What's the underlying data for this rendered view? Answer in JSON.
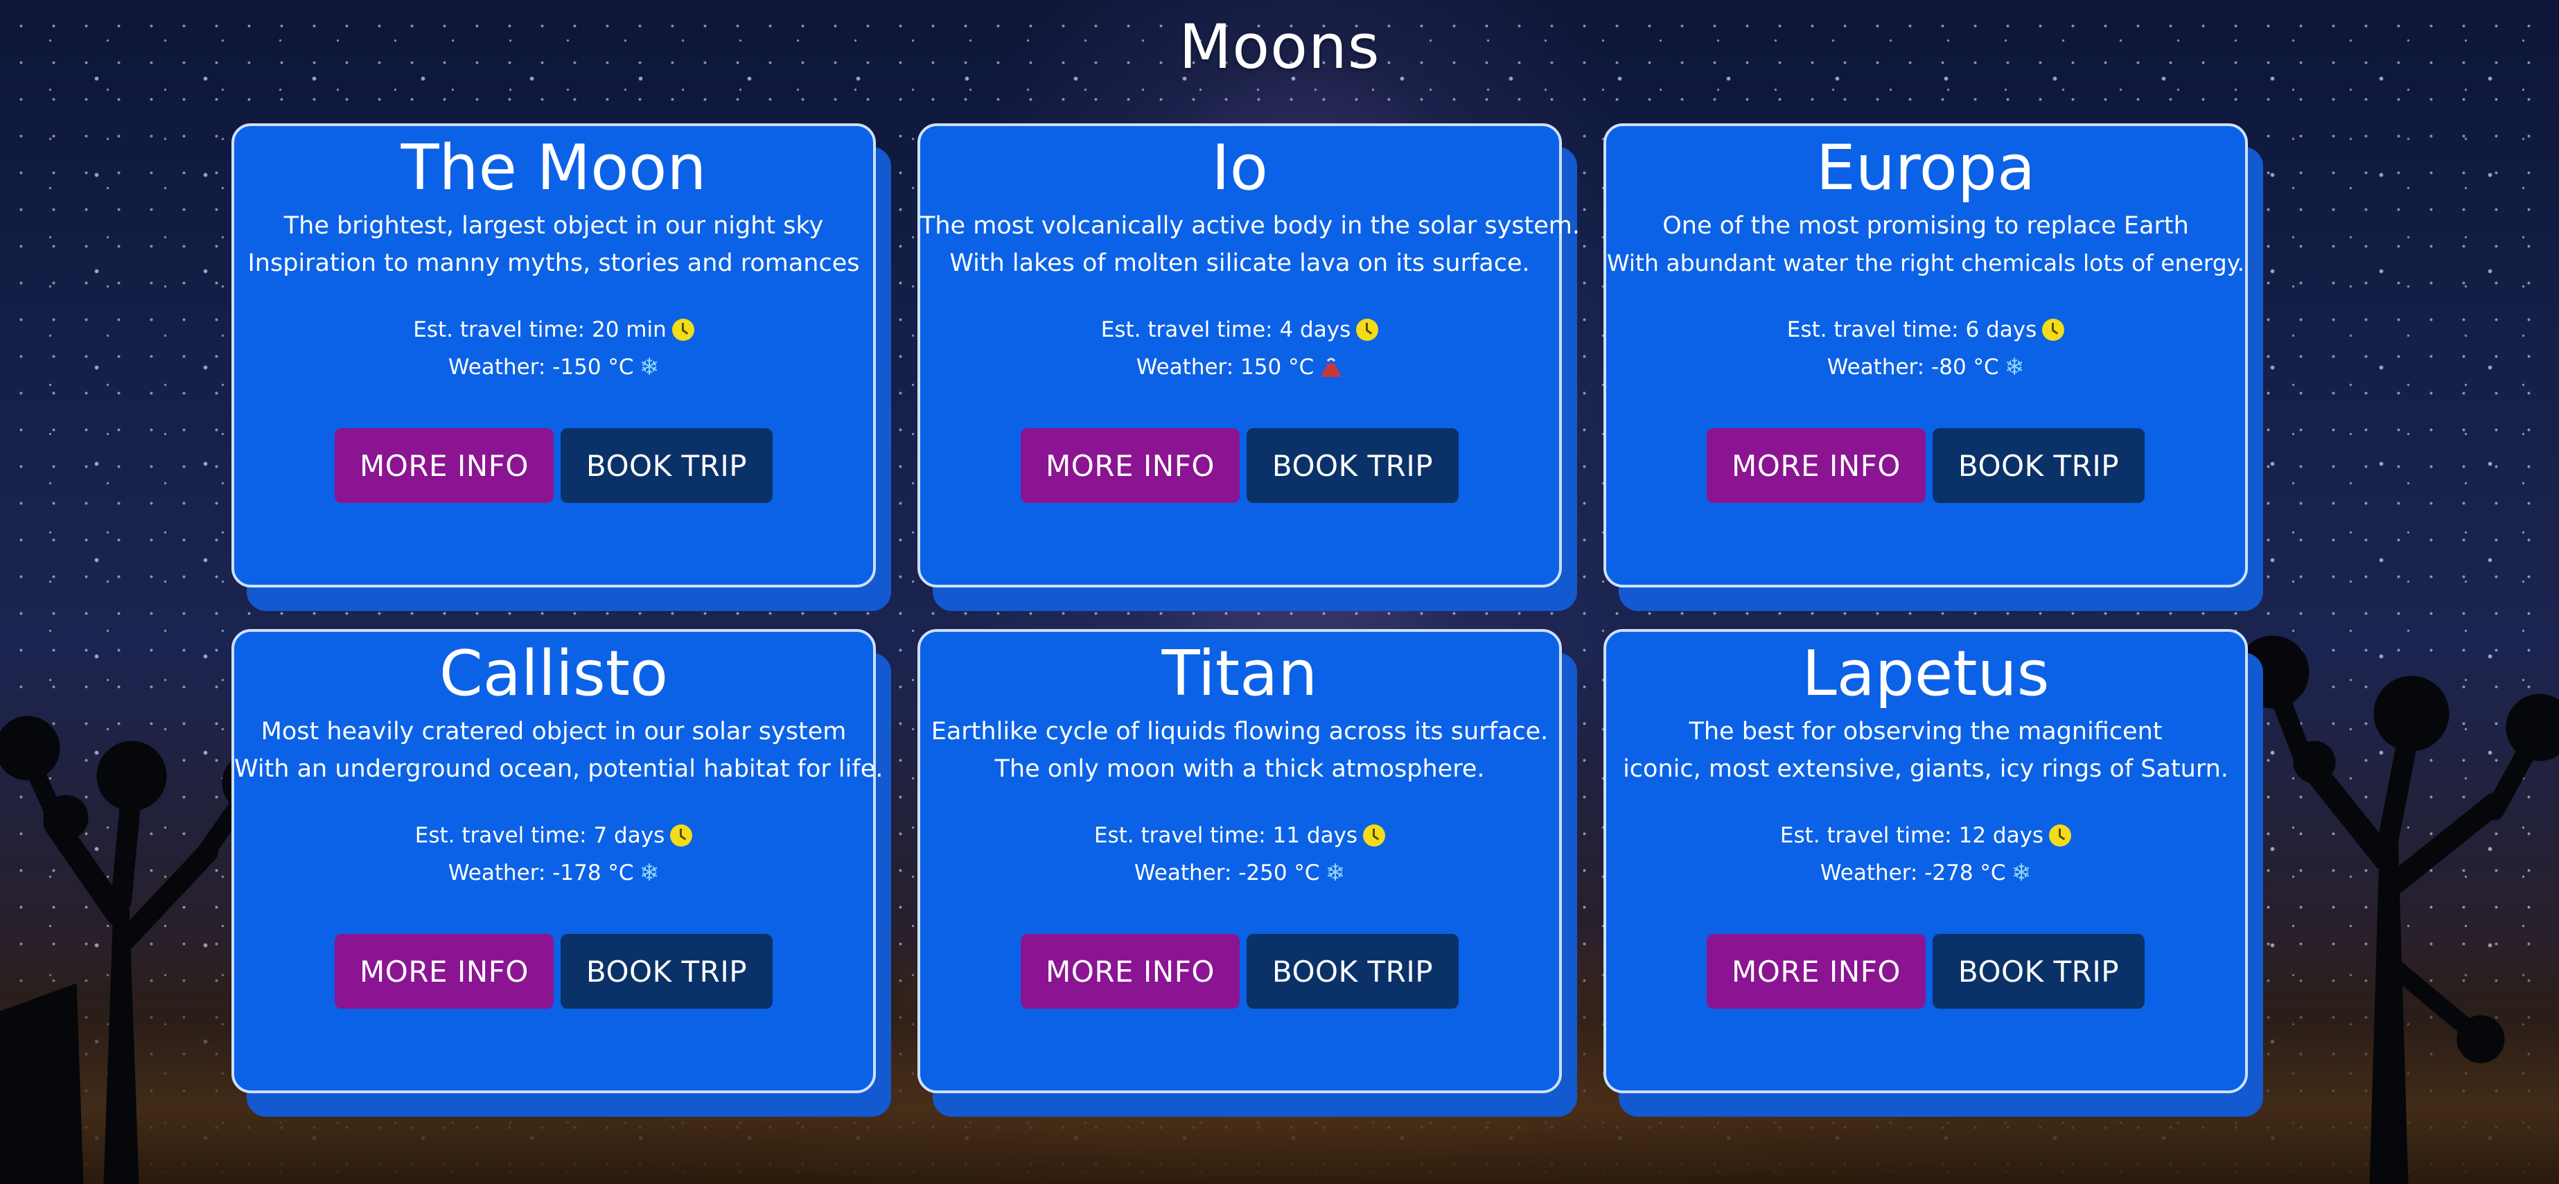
{
  "page": {
    "title": "Moons"
  },
  "colors": {
    "card_background": "#0b62e6",
    "card_border": "#cfe0ff",
    "more_info_button": "#8b1492",
    "book_trip_button": "#0a3268",
    "clock_icon": "#f3dc18",
    "snow_icon": "#8fd7ff",
    "volcano_icon": "#c93838"
  },
  "moons": [
    {
      "name": "The Moon",
      "description": [
        "The brightest, largest object in our night sky",
        "Inspiration to manny myths, stories and romances"
      ],
      "travel_time": "Est. travel time: 20 min",
      "weather": "Weather: -150 °C",
      "weather_icon": "snowflake-icon",
      "more_info_label": "MORE INFO",
      "book_trip_label": "BOOK TRIP"
    },
    {
      "name": "Io",
      "description": [
        "The most volcanically active body in the solar system.",
        "With lakes of molten silicate lava on its surface."
      ],
      "travel_time": "Est. travel time: 4 days",
      "weather": "Weather: 150 °C",
      "weather_icon": "volcano-icon",
      "more_info_label": "MORE INFO",
      "book_trip_label": "BOOK TRIP"
    },
    {
      "name": "Europa",
      "description": [
        "One of the most promising to replace Earth",
        "With abundant water the right chemicals lots of energy."
      ],
      "travel_time": "Est. travel time: 6 days",
      "weather": "Weather: -80 °C",
      "weather_icon": "snowflake-icon",
      "more_info_label": "MORE INFO",
      "book_trip_label": "BOOK TRIP"
    },
    {
      "name": "Callisto",
      "description": [
        "Most heavily cratered object in our solar system",
        "With an underground ocean, potential habitat for life."
      ],
      "travel_time": "Est. travel time: 7 days",
      "weather": "Weather: -178 °C",
      "weather_icon": "snowflake-icon",
      "more_info_label": "MORE INFO",
      "book_trip_label": "BOOK TRIP"
    },
    {
      "name": "Titan",
      "description": [
        "Earthlike cycle of liquids flowing across its surface.",
        "The only moon with a thick atmosphere."
      ],
      "travel_time": "Est. travel time: 11 days",
      "weather": "Weather: -250 °C",
      "weather_icon": "snowflake-icon",
      "more_info_label": "MORE INFO",
      "book_trip_label": "BOOK TRIP"
    },
    {
      "name": "Lapetus",
      "description": [
        "The best for observing the magnificent",
        "iconic, most extensive, giants, icy rings of Saturn."
      ],
      "travel_time": "Est. travel time: 12 days",
      "weather": "Weather: -278 °C",
      "weather_icon": "snowflake-icon",
      "more_info_label": "MORE INFO",
      "book_trip_label": "BOOK TRIP"
    }
  ]
}
